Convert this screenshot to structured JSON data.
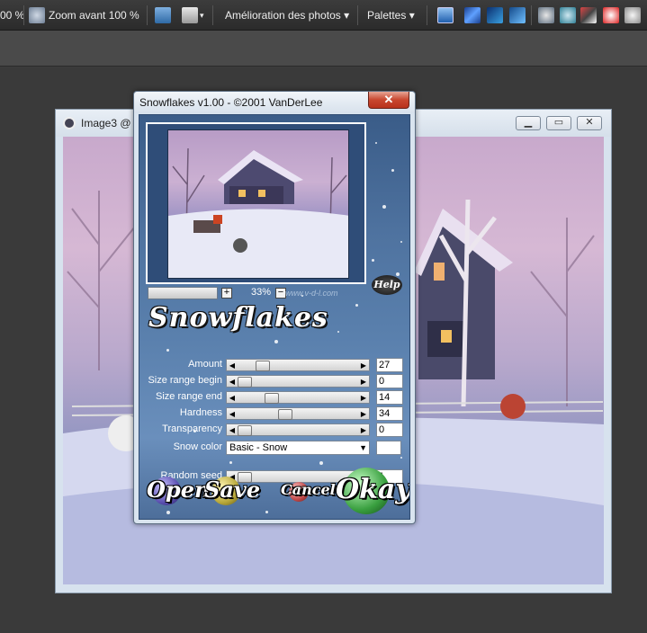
{
  "toolbar": {
    "zoom_percent": "00 %",
    "zoom_100": "Zoom avant 100 %",
    "photo_menu": "Amélioration des photos",
    "palettes_menu": "Palettes"
  },
  "image_window": {
    "title": "Image3 @"
  },
  "dialog": {
    "title": "Snowflakes v1.00 - ©2001 VanDerLee",
    "close_label": "✕",
    "zoom_value": "33%",
    "zoom_plus": "+",
    "zoom_minus": "−",
    "url": "www.v-d-l.com",
    "help_label": "Help",
    "logo_text": "Snowflakes",
    "params": [
      {
        "label": "Amount",
        "value": "27",
        "level": 0.17
      },
      {
        "label": "Size range begin",
        "value": "0",
        "level": 0.0
      },
      {
        "label": "Size range end",
        "value": "14",
        "level": 0.25
      },
      {
        "label": "Hardness",
        "value": "34",
        "level": 0.38
      },
      {
        "label": "Transparency",
        "value": "0",
        "level": 0.0
      }
    ],
    "snow_color_label": "Snow color",
    "snow_color_value": "Basic - Snow",
    "random_seed_label": "Random seed",
    "random_seed_value": "1",
    "random_seed_level": 0.0,
    "buttons": {
      "open": "Open",
      "save": "Save",
      "cancel": "Cancel",
      "okay": "Okay"
    }
  },
  "colors": {
    "dialog_bg": "#4f73a0",
    "close_button": "#c9472f",
    "okay_ball": "#3aa040",
    "open_ball": "#5a4fb0",
    "save_ball": "#b8a83a",
    "cancel_ball": "#c04848"
  }
}
